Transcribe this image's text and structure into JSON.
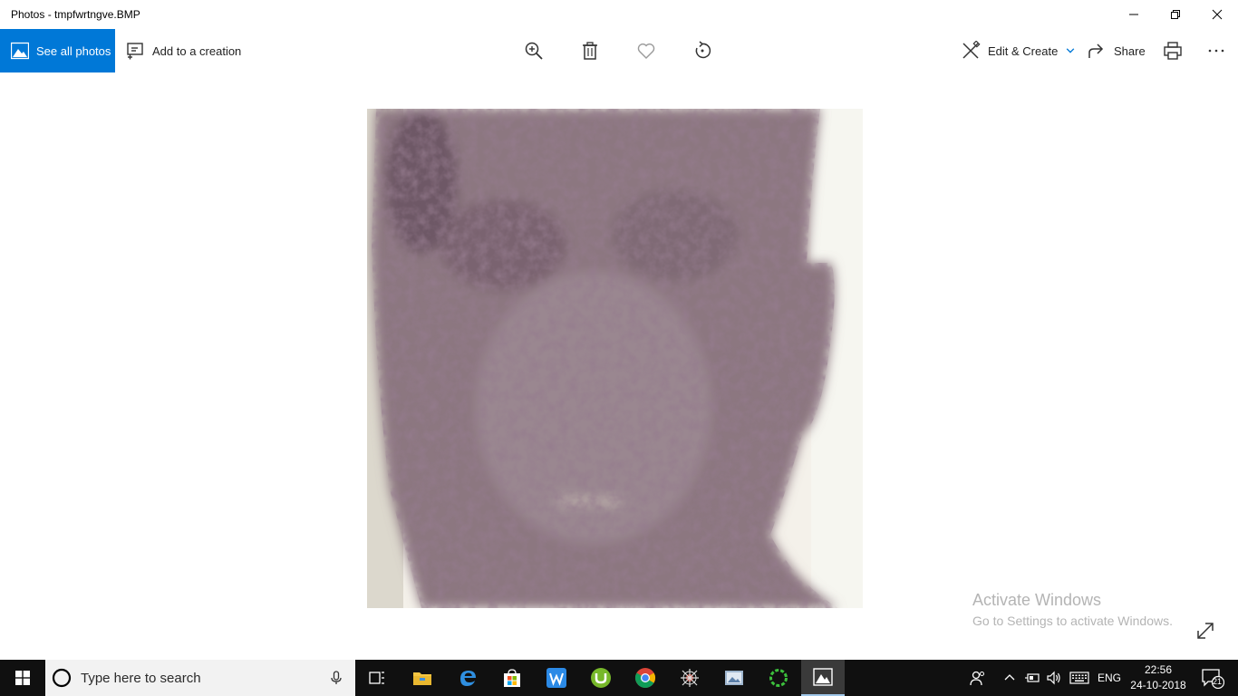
{
  "window": {
    "title": "Photos - tmpfwrtngve.BMP",
    "controls": [
      "minimize-icon",
      "restore-icon",
      "close-icon"
    ]
  },
  "toolbar": {
    "see_all_label": "See all photos",
    "add_creation_label": "Add to a creation",
    "center_icons": [
      "zoom-in-icon",
      "delete-icon",
      "heart-icon",
      "rotate-icon"
    ],
    "edit_create_label": "Edit & Create",
    "share_label": "Share",
    "print_icon": "print-icon",
    "more_icon": "more-icon",
    "accent": "#0078d7"
  },
  "watermark": {
    "line1": "Activate Windows",
    "line2": "Go to Settings to activate Windows."
  },
  "taskbar": {
    "search_placeholder": "Type here to search",
    "apps": [
      "task-view",
      "file-explorer",
      "edge",
      "store",
      "wps-writer",
      "utorrent",
      "chrome",
      "spider-app",
      "photos-viewer-app",
      "green-ring-app",
      "photos"
    ],
    "language": "ENG",
    "time": "22:56",
    "date": "24-10-2018",
    "notification_count": "21"
  }
}
